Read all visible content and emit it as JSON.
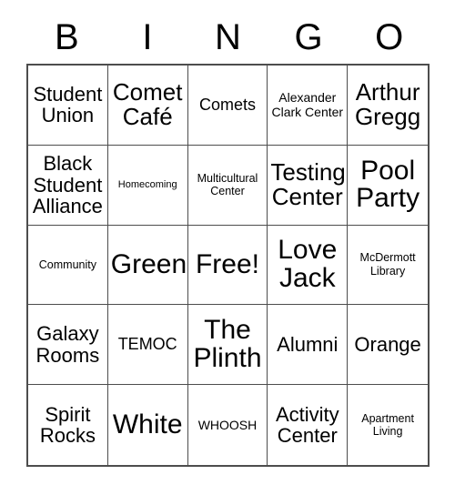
{
  "card": {
    "title": "BINGO",
    "header_letters": [
      "B",
      "I",
      "N",
      "G",
      "O"
    ],
    "free_space_label": "Free!",
    "colors": {
      "background": "#ffffff",
      "text": "#000000",
      "grid_line": "#4d4d4d"
    },
    "grid": {
      "columns": 5,
      "rows": 5,
      "cells": [
        {
          "text": "Student Union",
          "size": "l"
        },
        {
          "text": "Comet Café",
          "size": "xl"
        },
        {
          "text": "Comets",
          "size": "m"
        },
        {
          "text": "Alexander Clark Center",
          "size": "s"
        },
        {
          "text": "Arthur Gregg",
          "size": "xl"
        },
        {
          "text": "Black Student Alliance",
          "size": "l"
        },
        {
          "text": "Homecoming",
          "size": "xxs"
        },
        {
          "text": "Multicultural Center",
          "size": "xs"
        },
        {
          "text": "Testing Center",
          "size": "xl"
        },
        {
          "text": "Pool Party",
          "size": "xxl"
        },
        {
          "text": "Community",
          "size": "xs"
        },
        {
          "text": "Green",
          "size": "xxl"
        },
        {
          "text": "Free!",
          "size": "xxl"
        },
        {
          "text": "Love Jack",
          "size": "xxl"
        },
        {
          "text": "McDermott Library",
          "size": "xs"
        },
        {
          "text": "Galaxy Rooms",
          "size": "l"
        },
        {
          "text": "TEMOC",
          "size": "m"
        },
        {
          "text": "The Plinth",
          "size": "xxl"
        },
        {
          "text": "Alumni",
          "size": "l"
        },
        {
          "text": "Orange",
          "size": "l"
        },
        {
          "text": "Spirit Rocks",
          "size": "l"
        },
        {
          "text": "White",
          "size": "xxl"
        },
        {
          "text": "WHOOSH",
          "size": "s"
        },
        {
          "text": "Activity Center",
          "size": "l"
        },
        {
          "text": "Apartment Living",
          "size": "xs"
        }
      ]
    }
  }
}
